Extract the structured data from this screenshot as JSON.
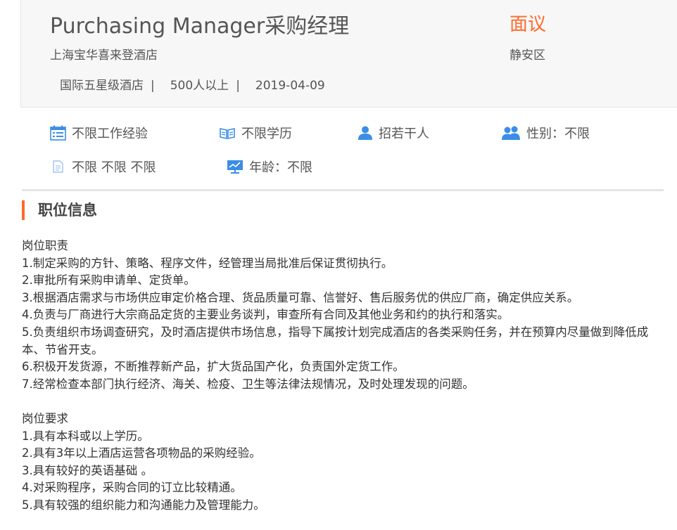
{
  "job": {
    "title": "Purchasing Manager采购经理",
    "salary": "面议",
    "company": "上海宝华喜来登酒店",
    "district": "静安区",
    "meta": [
      "国际五星级酒店",
      "|",
      "500人以上",
      "|",
      "2019-04-09"
    ]
  },
  "attributes": {
    "experience": "不限工作经验",
    "education": "不限学历",
    "headcount": "招若干人",
    "gender": "性别：不限",
    "other": "不限 不限 不限",
    "age": "年龄：不限"
  },
  "icons": {
    "experience": "calendar-icon",
    "education": "book-icon",
    "headcount": "person-icon",
    "gender": "people-icon",
    "other": "document-icon",
    "age": "monitor-chart-icon"
  },
  "colors": {
    "accent": "#ff6a2c",
    "icon_blue": "#3a8ee6"
  },
  "section": {
    "title": "职位信息"
  },
  "description": {
    "duties_heading": "岗位职责",
    "duties": [
      "1.制定采购的方针、策略、程序文件，经管理当局批准后保证贯彻执行。",
      "2.审批所有采购申请单、定货单。",
      "3.根据酒店需求与市场供应审定价格合理、货品质量可靠、信誉好、售后服务优的供应厂商，确定供应关系。",
      "4.负责与厂商进行大宗商品定货的主要业务谈判，审查所有合同及其他业务和约的执行和落实。",
      "5.负责组织市场调查研究，及时酒店提供市场信息，指导下属按计划完成酒店的各类采购任务，并在预算内尽量做到降低成本、节省开支。",
      "6.积极开发货源，不断推荐新产品，扩大货品国产化，负责国外定货工作。",
      "7.经常检查本部门执行经济、海关、检疫、卫生等法律法规情况，及时处理发现的问题。"
    ],
    "requirements_heading": "岗位要求",
    "requirements": [
      "1.具有本科或以上学历。",
      "2.具有3年以上酒店运营各项物品的采购经验。",
      "3.具有较好的英语基础 。",
      "4.对采购程序，采购合同的订立比较精通。",
      "5.具有较强的组织能力和沟通能力及管理能力。"
    ]
  }
}
